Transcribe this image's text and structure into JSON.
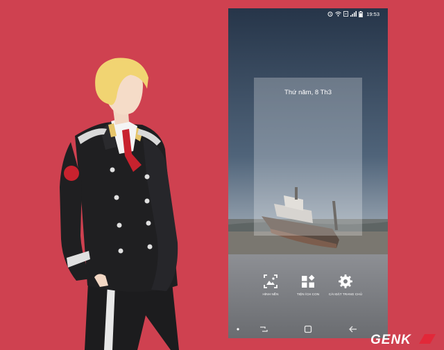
{
  "status_bar": {
    "time": "19:53",
    "icons": [
      "alarm-icon",
      "wifi-icon",
      "data-icon",
      "signal-icon",
      "battery-icon"
    ]
  },
  "preview": {
    "date": "Thứ năm, 8 Th3"
  },
  "options": [
    {
      "label": "HÌNH NỀN",
      "icon": "wallpaper-icon"
    },
    {
      "label": "TIỆN ÍCH CON",
      "icon": "widgets-icon"
    },
    {
      "label": "CÀI ĐẶT TRANG CHỦ",
      "icon": "gear-icon"
    }
  ],
  "nav_bar": {
    "buttons": [
      "recent-apps-icon",
      "home-icon",
      "back-icon"
    ]
  },
  "logo": {
    "text": "GENK"
  },
  "colors": {
    "background": "#cf4150",
    "uniform": "#1f1f21",
    "hair": "#f1d472",
    "accent_red": "#c8222e"
  }
}
